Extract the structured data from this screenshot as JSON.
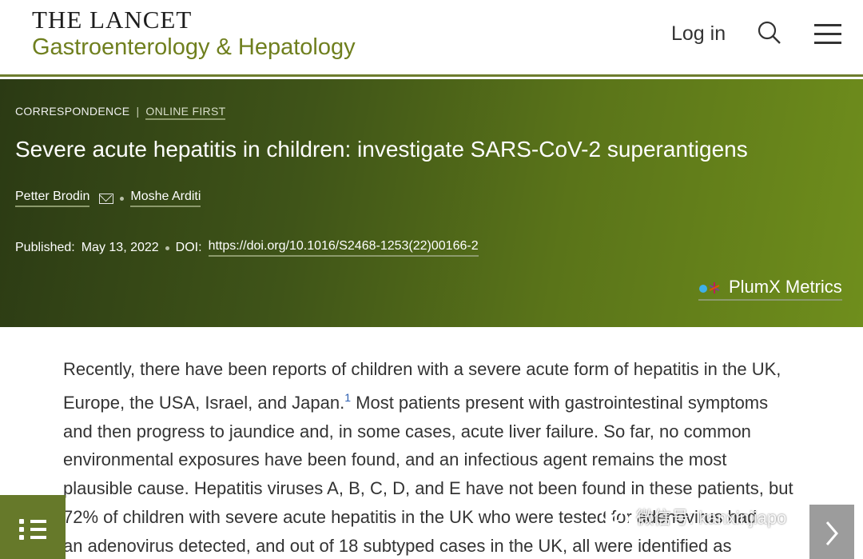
{
  "header": {
    "brand_top": "THE LANCET",
    "brand_sub": "Gastroenterology & Hepatology",
    "login_label": "Log in"
  },
  "article": {
    "section": "CORRESPONDENCE",
    "status": "ONLINE FIRST",
    "title": "Severe acute hepatitis in children: investigate SARS-CoV-2 superantigens",
    "authors": [
      "Petter Brodin",
      "Moshe Arditi"
    ],
    "published_label": "Published:",
    "published_date": "May 13, 2022",
    "doi_label": "DOI:",
    "doi_url": "https://doi.org/10.1016/S2468-1253(22)00166-2",
    "metrics_label": "PlumX Metrics"
  },
  "body": {
    "lines": [
      "Recently, there have been reports of children with a severe acute form of hepatitis in the UK,",
      "Europe, the USA, Israel, and Japan.",
      " Most patients present with gastrointestinal symptoms",
      "and then progress to jaundice and, in some cases, acute liver failure. So far, no common",
      "environmental exposures have been found, and an infectious agent remains the most",
      "plausible cause. Hepatitis viruses A, B, C, D, and E have not been found in these patients, but",
      "72% of children with severe acute hepatitis in the UK who were tested for adenovirus had",
      "an adenovirus detected, and out of 18 subtyped cases in the UK, all were identified as"
    ],
    "ref1": "1"
  },
  "watermark": {
    "text": "微信号: kanxinjiapo"
  },
  "icons": {
    "search": "search-icon",
    "menu": "hamburger-menu-icon",
    "mail": "mail-icon",
    "plumx": "plumx-icon",
    "toc": "list-icon",
    "next": "chevron-right-icon"
  },
  "colors": {
    "brand_green": "#6f7f1e",
    "hero_dark": "#2b3a14",
    "hero_light": "#6f8e1c",
    "toc_button": "#66792a",
    "link_blue": "#2a5db0"
  }
}
